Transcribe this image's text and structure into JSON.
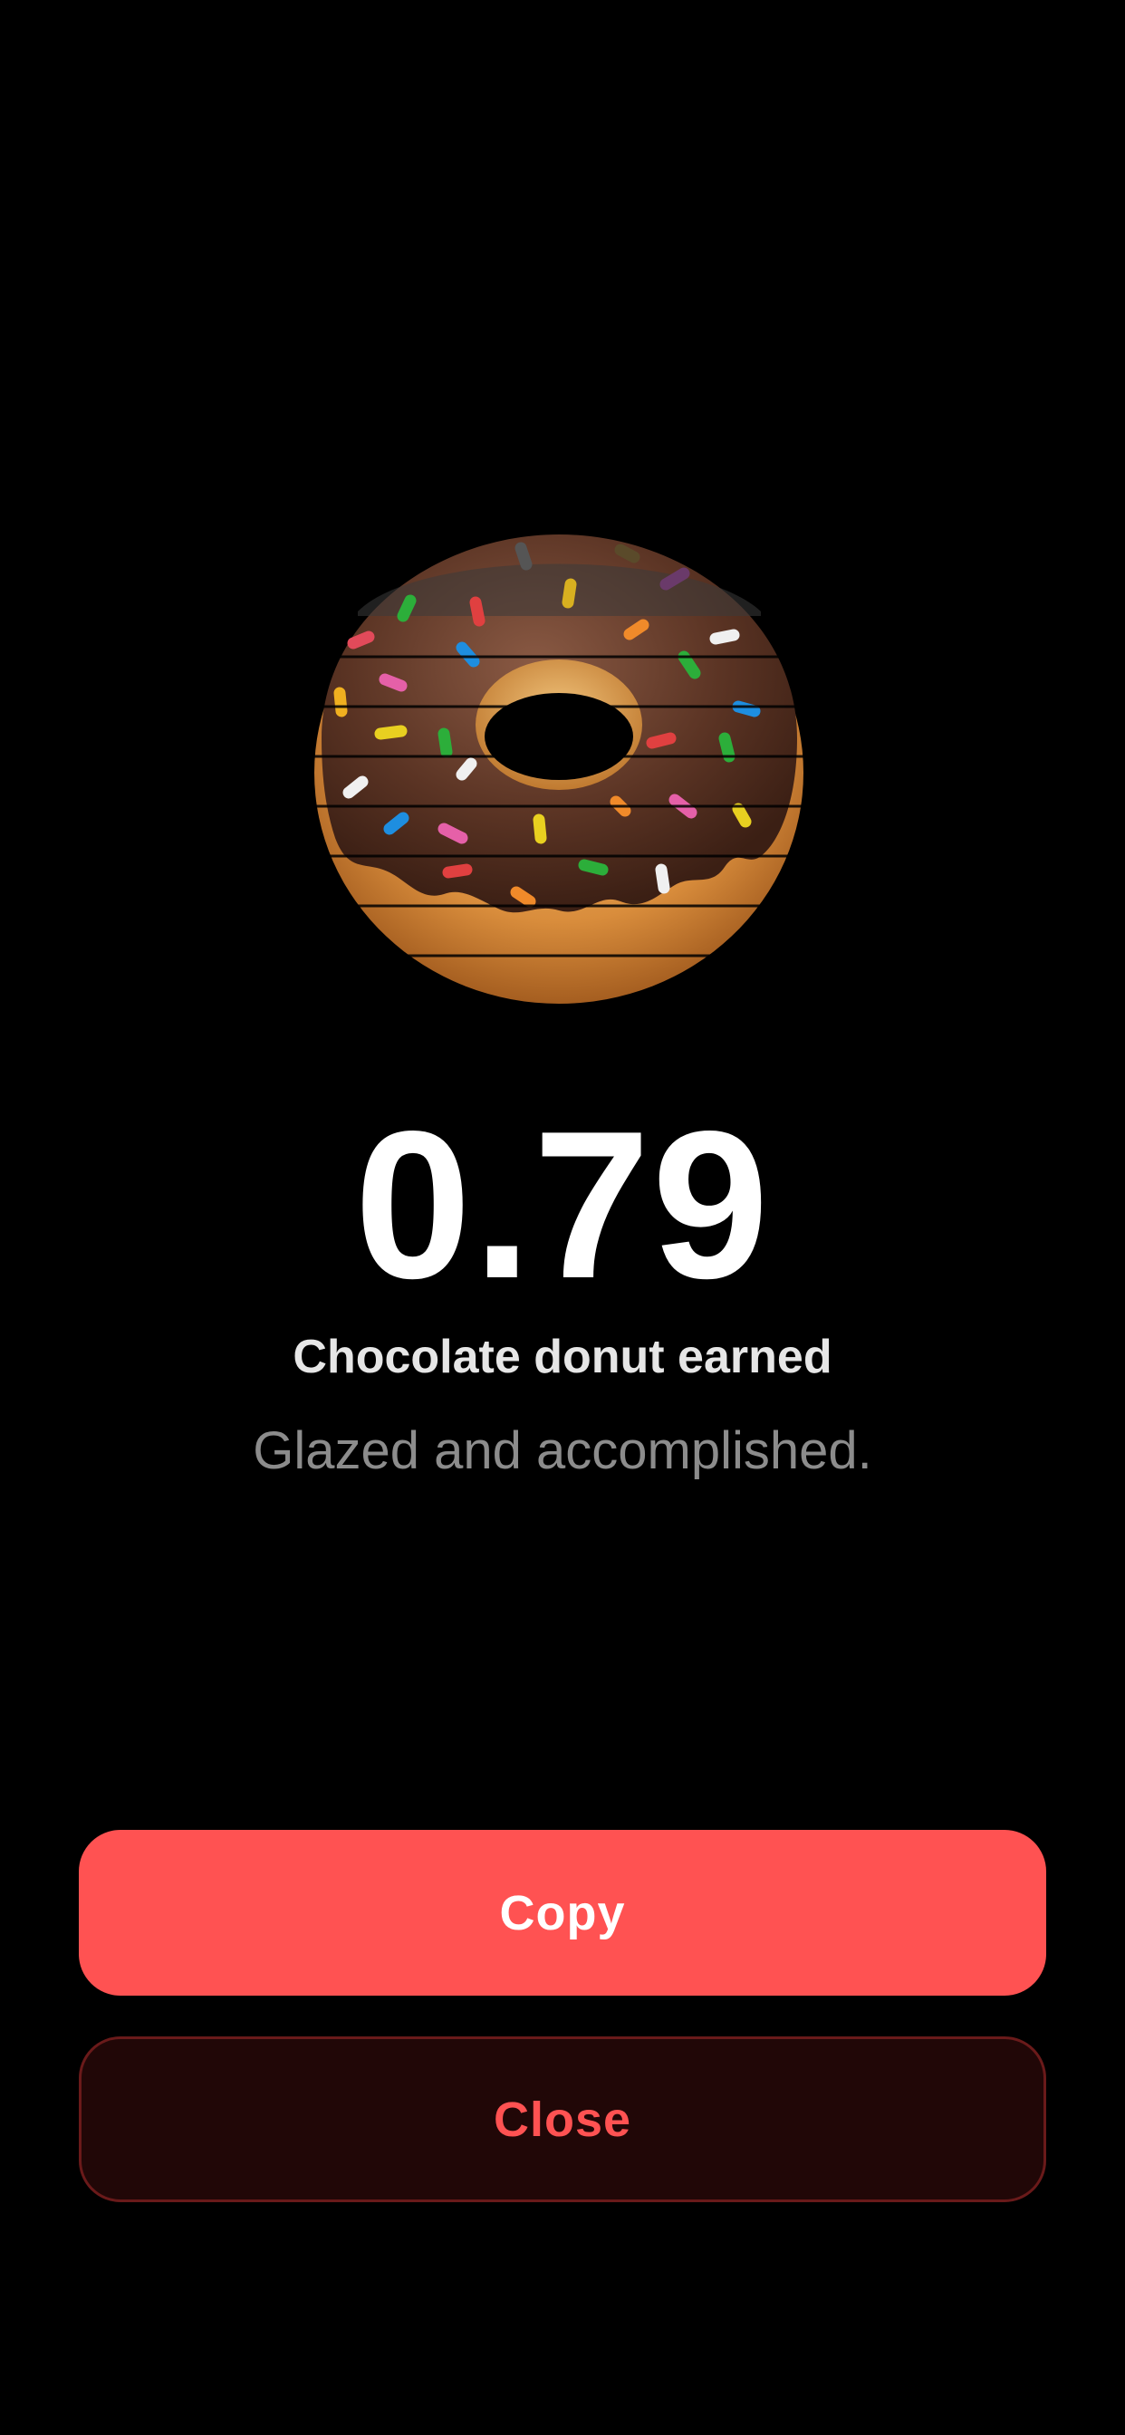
{
  "reward": {
    "image_icon": "chocolate-donut-icon",
    "score": "0.79",
    "title": "Chocolate donut earned",
    "tagline": "Glazed and accomplished."
  },
  "actions": {
    "copy_label": "Copy",
    "close_label": "Close"
  },
  "colors": {
    "background": "#000000",
    "accent": "#ff5252",
    "close_bg": "#210707",
    "close_border": "#6a1a1a"
  }
}
